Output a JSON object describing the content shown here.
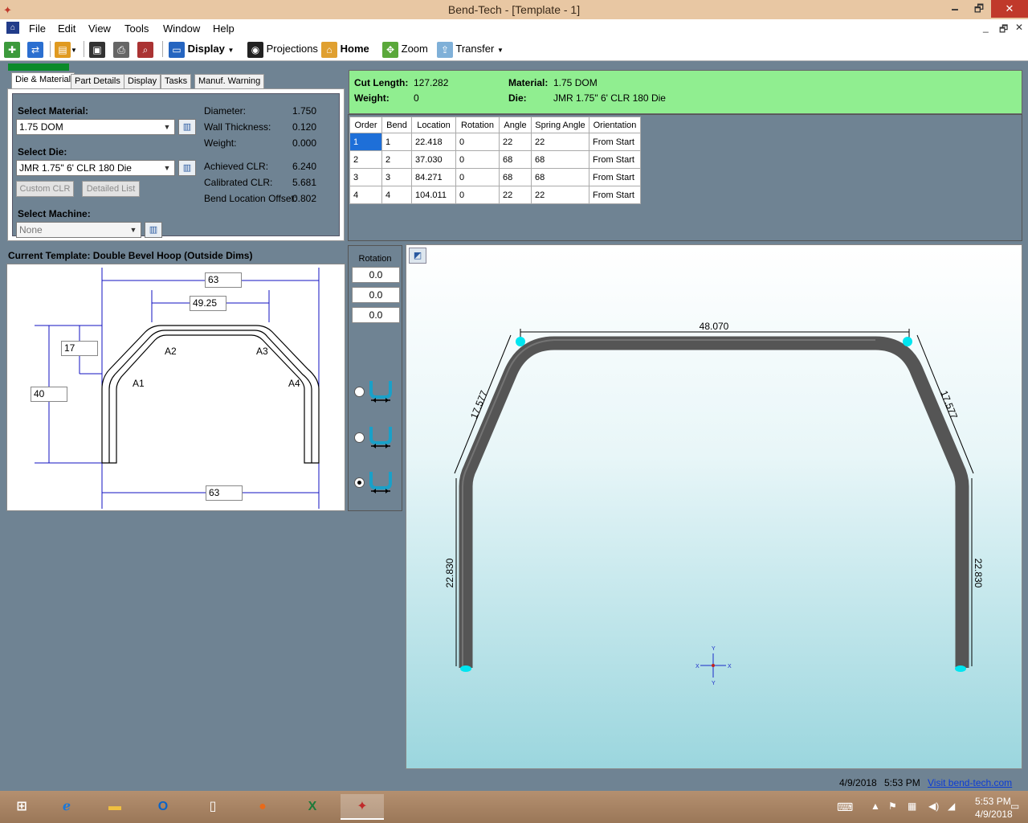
{
  "window": {
    "title": "Bend-Tech - [Template - 1]",
    "minimize": "🗕",
    "maximize": "🗗",
    "close": "✕"
  },
  "menu": {
    "items": [
      "File",
      "Edit",
      "View",
      "Tools",
      "Window",
      "Help"
    ],
    "mdi_min": "_",
    "mdi_restore": "🗗",
    "mdi_close": "✕"
  },
  "toolbar": {
    "display": "Display",
    "projections": "Projections",
    "home": "Home",
    "zoom": "Zoom",
    "transfer": "Transfer"
  },
  "tabs": [
    "Die & Material",
    "Part Details",
    "Display",
    "Tasks",
    "Manuf. Warning"
  ],
  "die_material": {
    "select_material_label": "Select Material:",
    "material_value": "1.75 DOM",
    "select_die_label": "Select Die:",
    "die_value": "JMR 1.75\" 6' CLR 180 Die",
    "custom_clr": "Custom CLR",
    "detailed_list": "Detailed List",
    "select_machine_label": "Select Machine:",
    "machine_value": "None",
    "props": [
      {
        "label": "Diameter:",
        "value": "1.750"
      },
      {
        "label": "Wall Thickness:",
        "value": "0.120"
      },
      {
        "label": "Weight:",
        "value": "0.000"
      },
      {
        "label": "Achieved CLR:",
        "value": "6.240"
      },
      {
        "label": "Calibrated CLR:",
        "value": "5.681"
      },
      {
        "label": "Bend Location Offset:",
        "value": "0.802"
      }
    ]
  },
  "template": {
    "label": "Current Template: Double Bevel Hoop (Outside Dims)",
    "dims": {
      "top_width": "63",
      "inner_width": "49.25",
      "bevel_height": "17",
      "total_height": "40",
      "bottom_width": "63"
    },
    "angles": [
      "A1",
      "A2",
      "A3",
      "A4"
    ]
  },
  "info": {
    "cut_length_label": "Cut Length:",
    "cut_length": "127.282",
    "weight_label": "Weight:",
    "weight": "0",
    "material_label": "Material:",
    "material": "1.75 DOM",
    "die_label": "Die:",
    "die": "JMR 1.75\" 6' CLR 180 Die"
  },
  "bend_table": {
    "headers": [
      "Order",
      "Bend",
      "Location",
      "Rotation",
      "Angle",
      "Spring Angle",
      "Orientation"
    ],
    "rows": [
      [
        "1",
        "1",
        "22.418",
        "0",
        "22",
        "22",
        "From Start"
      ],
      [
        "2",
        "2",
        "37.030",
        "0",
        "68",
        "68",
        "From Start"
      ],
      [
        "3",
        "3",
        "84.271",
        "0",
        "68",
        "68",
        "From Start"
      ],
      [
        "4",
        "4",
        "104.011",
        "0",
        "22",
        "22",
        "From Start"
      ]
    ]
  },
  "rotation": {
    "label": "Rotation",
    "values": [
      "0.0",
      "0.0",
      "0.0"
    ],
    "selected_option": 3
  },
  "view3d": {
    "dims": {
      "top": "48.070",
      "left_bevel": "17.577",
      "right_bevel": "17.577",
      "left_leg": "22.830",
      "right_leg": "22.830"
    },
    "axis": {
      "x": "X",
      "y": "Y"
    },
    "colors": {
      "tube": "#555555",
      "marker": "#00e5f0",
      "dim_line": "#000000"
    }
  },
  "status": {
    "date": "4/9/2018",
    "time": "5:53 PM",
    "link": "Visit bend-tech.com"
  },
  "taskbar": {
    "time": "5:53 PM",
    "date": "4/9/2018"
  }
}
